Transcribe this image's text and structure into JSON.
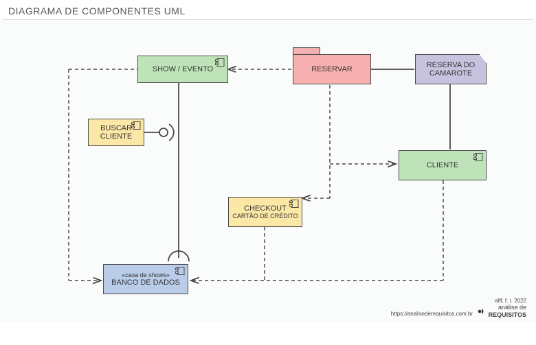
{
  "title": "DIAGRAMA DE COMPONENTES UML",
  "nodes": {
    "show_evento": {
      "label": "SHOW / EVENTO"
    },
    "buscar_cliente": {
      "label1": "BUSCAR",
      "label2": "CLIENTE"
    },
    "reservar": {
      "label": "RESERVAR"
    },
    "reserva_camarote": {
      "label1": "RESERVA DO",
      "label2": "CAMAROTE"
    },
    "cliente": {
      "label": "CLIENTE"
    },
    "checkout": {
      "label1": "CHECKOUT",
      "label2": "CARTÃO DE CRÉDITO"
    },
    "banco_dados": {
      "stereotype": "«casa de shows»",
      "label": "BANCO DE DADOS"
    }
  },
  "interface": {
    "name": "required-interface"
  },
  "footer": {
    "credit": "alff, f. r. 2022",
    "url": "https://analisederequisitos.com.br",
    "brand1": "análise de",
    "brand2": "REQUISITOS"
  }
}
